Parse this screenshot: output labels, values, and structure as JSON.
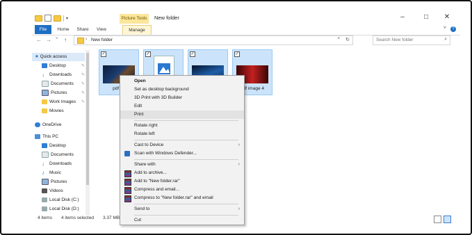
{
  "window": {
    "title": "New folder",
    "context_tab_group": "Picture Tools"
  },
  "ribbon": {
    "tabs": [
      "File",
      "Home",
      "Share",
      "View",
      "Manage"
    ]
  },
  "address": {
    "path": "New folder",
    "search_placeholder": "Search New folder"
  },
  "nav": {
    "items": [
      {
        "label": "Quick access",
        "icon": "star-icon"
      },
      {
        "label": "Desktop",
        "icon": "desktop-icon"
      },
      {
        "label": "Downloads",
        "icon": "download-icon"
      },
      {
        "label": "Documents",
        "icon": "documents-icon"
      },
      {
        "label": "Pictures",
        "icon": "pictures-icon"
      },
      {
        "label": "Work Images",
        "icon": "folder-icon"
      },
      {
        "label": "Movies",
        "icon": "folder-icon"
      },
      {
        "label": "OneDrive",
        "icon": "cloud-icon"
      },
      {
        "label": "This PC",
        "icon": "computer-icon"
      },
      {
        "label": "Desktop",
        "icon": "desktop-icon"
      },
      {
        "label": "Documents",
        "icon": "documents-icon"
      },
      {
        "label": "Downloads",
        "icon": "download-icon"
      },
      {
        "label": "Music",
        "icon": "music-icon"
      },
      {
        "label": "Pictures",
        "icon": "pictures-icon"
      },
      {
        "label": "Videos",
        "icon": "videos-icon"
      },
      {
        "label": "Local Disk (C:)",
        "icon": "disk-icon"
      },
      {
        "label": "Local Disk (D:)",
        "icon": "disk-icon"
      }
    ]
  },
  "files": [
    {
      "label": "pdf im",
      "selected": true
    },
    {
      "label": "",
      "selected": true
    },
    {
      "label": "",
      "selected": true
    },
    {
      "label": "pdf image 4",
      "selected": true
    }
  ],
  "status": {
    "count": "4 items",
    "selected": "4 items selected",
    "size": "3.37 MB"
  },
  "context_menu": {
    "items": [
      {
        "label": "Open",
        "bold": true
      },
      {
        "label": "Set as desktop background"
      },
      {
        "label": "3D Print with 3D Builder"
      },
      {
        "label": "Edit"
      },
      {
        "label": "Print",
        "highlighted": true
      },
      {
        "label": "Rotate right"
      },
      {
        "label": "Rotate left"
      },
      {
        "label": "Cast to Device",
        "submenu": true
      },
      {
        "label": "Scan with Windows Defender...",
        "icon": "defender-shield-icon"
      },
      {
        "label": "Share with",
        "submenu": true
      },
      {
        "label": "Add to archive...",
        "icon": "winrar-icon"
      },
      {
        "label": "Add to \"New folder.rar\"",
        "icon": "winrar-icon"
      },
      {
        "label": "Compress and email...",
        "icon": "winrar-icon"
      },
      {
        "label": "Compress to \"New folder.rar\" and email",
        "icon": "winrar-icon"
      },
      {
        "label": "Send to",
        "submenu": true
      },
      {
        "label": "Cut"
      }
    ]
  },
  "colors": {
    "accent": "#1d6fc3",
    "selection": "#cce4fb",
    "context_tab": "#fbe69a"
  }
}
